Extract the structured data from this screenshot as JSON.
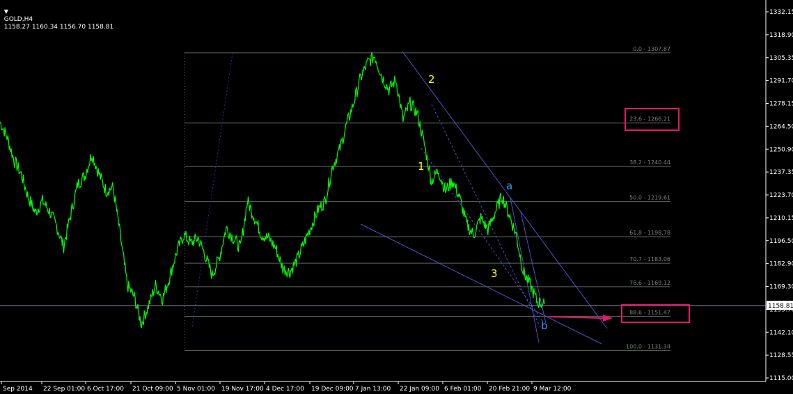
{
  "header": {
    "collapse_icon": "triangle-down-icon",
    "symbol": "GOLD,H4",
    "ohlc": "1158.27 1160.34 1156.70 1158.81"
  },
  "colors": {
    "background": "#000000",
    "price": "#00ff00",
    "fib_line": "#5a6a5a",
    "fib_label": "#7f7f7f",
    "trendline": "#5050cc",
    "wave_yellow": "#ffff00",
    "wave_blue": "#3399ff",
    "highlight": "#e8176f",
    "axis": "#ffffff"
  },
  "current_price": "1158.81",
  "price_axis": [
    "1332.15",
    "1318.90",
    "1305.35",
    "1291.70",
    "1278.15",
    "1264.50",
    "1250.90",
    "1237.35",
    "1223.70",
    "1210.15",
    "1196.50",
    "1182.90",
    "1169.30",
    "1155.70",
    "1142.10",
    "1128.55",
    "1115.00"
  ],
  "time_axis": [
    "Sep 2014",
    "22 Sep 01:00",
    "6 Oct 17:00",
    "21 Oct 09:00",
    "5 Nov 01:00",
    "19 Nov 17:00",
    "4 Dec 17:00",
    "19 Dec 09:00",
    "7 Jan 13:00",
    "22 Jan 09:00",
    "6 Feb 01:00",
    "20 Feb 21:00",
    "9 Mar 12:00"
  ],
  "fib_levels": [
    {
      "label": "0.0 - 1307.87",
      "price": 1307.87
    },
    {
      "label": "23.6 - 1266.21",
      "price": 1266.21
    },
    {
      "label": "38.2 - 1240.44",
      "price": 1240.44
    },
    {
      "label": "50.0 - 1219.61",
      "price": 1219.61
    },
    {
      "label": "61.8 - 1198.78",
      "price": 1198.78
    },
    {
      "label": "70.7 - 1183.06",
      "price": 1183.06
    },
    {
      "label": "78.6 - 1169.12",
      "price": 1169.12
    },
    {
      "label": "88.6 - 1151.47",
      "price": 1151.47
    },
    {
      "label": "100.0 - 1131.34",
      "price": 1131.34
    }
  ],
  "wave_labels": {
    "w1": "1",
    "w2": "2",
    "w3": "3",
    "wa": "a",
    "wb": "b"
  },
  "chart_data": {
    "type": "line",
    "title": "GOLD,H4",
    "series": [
      {
        "name": "GOLD,H4",
        "points": [
          [
            "Sep 2014",
            1267
          ],
          [
            "",
            1258
          ],
          [
            "",
            1244
          ],
          [
            "",
            1236
          ],
          [
            "22 Sep 01:00",
            1222
          ],
          [
            "",
            1213
          ],
          [
            "",
            1220
          ],
          [
            "",
            1214
          ],
          [
            "6 Oct 17:00",
            1205
          ],
          [
            "",
            1193
          ],
          [
            "",
            1212
          ],
          [
            "",
            1230
          ],
          [
            "",
            1235
          ],
          [
            "21 Oct 09:00",
            1248
          ],
          [
            "",
            1236
          ],
          [
            "",
            1226
          ],
          [
            "",
            1228
          ],
          [
            "",
            1200
          ],
          [
            "",
            1170
          ],
          [
            "",
            1163
          ],
          [
            "5 Nov 01:00",
            1147
          ],
          [
            "",
            1158
          ],
          [
            "",
            1170
          ],
          [
            "",
            1162
          ],
          [
            "",
            1175
          ],
          [
            "",
            1190
          ],
          [
            "",
            1200
          ],
          [
            "19 Nov 17:00",
            1195
          ],
          [
            "",
            1198
          ],
          [
            "",
            1188
          ],
          [
            "",
            1176
          ],
          [
            "",
            1186
          ],
          [
            "",
            1204
          ],
          [
            "",
            1198
          ],
          [
            "4 Dec 17:00",
            1192
          ],
          [
            "",
            1220
          ],
          [
            "",
            1210
          ],
          [
            "",
            1200
          ],
          [
            "",
            1198
          ],
          [
            "",
            1192
          ],
          [
            "19 Dec 09:00",
            1180
          ],
          [
            "",
            1178
          ],
          [
            "",
            1185
          ],
          [
            "",
            1195
          ],
          [
            "",
            1205
          ],
          [
            "",
            1215
          ],
          [
            "7 Jan 13:00",
            1220
          ],
          [
            "",
            1240
          ],
          [
            "",
            1250
          ],
          [
            "",
            1265
          ],
          [
            "",
            1278
          ],
          [
            "",
            1293
          ],
          [
            "22 Jan 09:00",
            1302
          ],
          [
            "",
            1306
          ],
          [
            "",
            1294
          ],
          [
            "",
            1286
          ],
          [
            "",
            1292
          ],
          [
            "",
            1268
          ],
          [
            "",
            1278
          ],
          [
            "",
            1272
          ],
          [
            "6 Feb 01:00",
            1254
          ],
          [
            "",
            1232
          ],
          [
            "",
            1238
          ],
          [
            "",
            1226
          ],
          [
            "",
            1232
          ],
          [
            "",
            1222
          ],
          [
            "",
            1206
          ],
          [
            "",
            1200
          ],
          [
            "20 Feb 21:00",
            1210
          ],
          [
            "",
            1203
          ],
          [
            "",
            1213
          ],
          [
            "",
            1223
          ],
          [
            "",
            1212
          ],
          [
            "",
            1200
          ],
          [
            "9 Mar 12:00",
            1178
          ],
          [
            "",
            1170
          ],
          [
            "",
            1160
          ],
          [
            "",
            1158.81
          ]
        ]
      }
    ],
    "ylim": [
      1115.0,
      1332.15
    ],
    "grid": false
  }
}
